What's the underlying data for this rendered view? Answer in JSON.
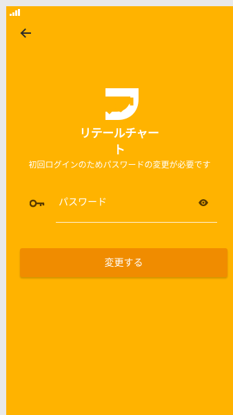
{
  "app": {
    "brand_name": "リテールチャート"
  },
  "nav": {
    "back_icon": "arrow-back-icon"
  },
  "status_bar": {
    "signal_icon": "signal-strength-icon"
  },
  "screen": {
    "notice": "初回ログインのためパスワードの変更が必要です"
  },
  "form": {
    "password_placeholder": "パスワード",
    "password_value": "",
    "key_icon": "key-icon",
    "visibility_icon": "eye-icon",
    "submit_label": "変更する"
  },
  "colors": {
    "background": "#ffb300",
    "button": "#f08c00",
    "text": "#ffffff"
  }
}
